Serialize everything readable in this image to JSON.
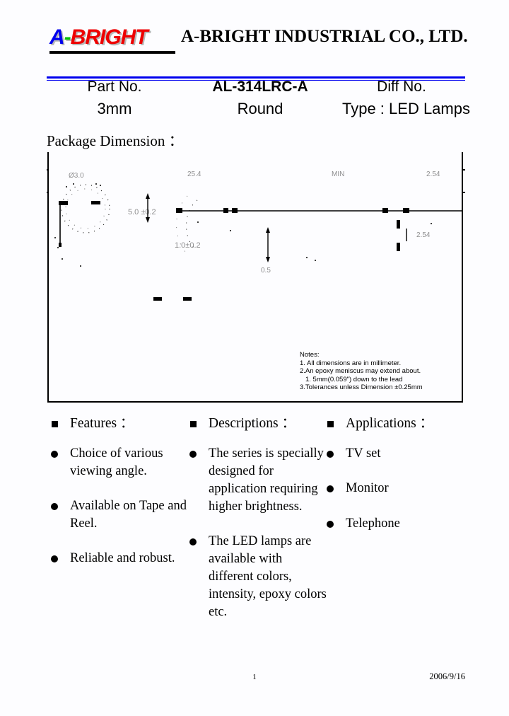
{
  "masthead": {
    "logo": {
      "letter_a": "A",
      "dash": "-",
      "word": "BRIGHT"
    },
    "company_name": "A-BRIGHT INDUSTRIAL CO., LTD.",
    "accent_color": "#0000ee",
    "logo_colors": {
      "a": "#0000ee",
      "dash": "#00c000",
      "bright": "#ee0000"
    }
  },
  "part_header": {
    "row1": {
      "label": "Part No.",
      "part_number": "AL-314LRC-A",
      "diff_label": "Diff No."
    },
    "row2": {
      "size": "3mm",
      "shape": "Round",
      "type": "Type : LED Lamps"
    }
  },
  "section": {
    "package_dimension_title": "Package Dimension ："
  },
  "drawing": {
    "notes_title": "Notes:",
    "note_1": "1. All dimensions are in millimeter.",
    "note_2": "2.An epoxy meniscus may extend about.",
    "note_2b": "1. 5mm(0.059\") down to the lead",
    "note_3": "3.Tolerances unless Dimension ±0.25mm",
    "dim_labels": {
      "top_left": "Ø3.0",
      "center_height": "5.0 ±0.2",
      "lead_gap": "1.0±0.2",
      "lead_width": "0.5",
      "top_right_1": "25.4",
      "top_right_2": "MIN",
      "right": "2.54"
    }
  },
  "columns": {
    "features": {
      "heading": "Features ：",
      "items": [
        "Choice of various viewing angle.",
        "Available on Tape and Reel.",
        "Reliable and robust."
      ]
    },
    "descriptions": {
      "heading": "Descriptions ：",
      "items": [
        "The series is specially designed for application requiring higher brightness.",
        "The LED lamps are available with different colors, intensity, epoxy colors etc."
      ]
    },
    "applications": {
      "heading": "Applications ：",
      "items": [
        "TV set",
        "Monitor",
        "Telephone"
      ]
    }
  },
  "footer": {
    "page_number": "1",
    "date": "2006/9/16"
  }
}
